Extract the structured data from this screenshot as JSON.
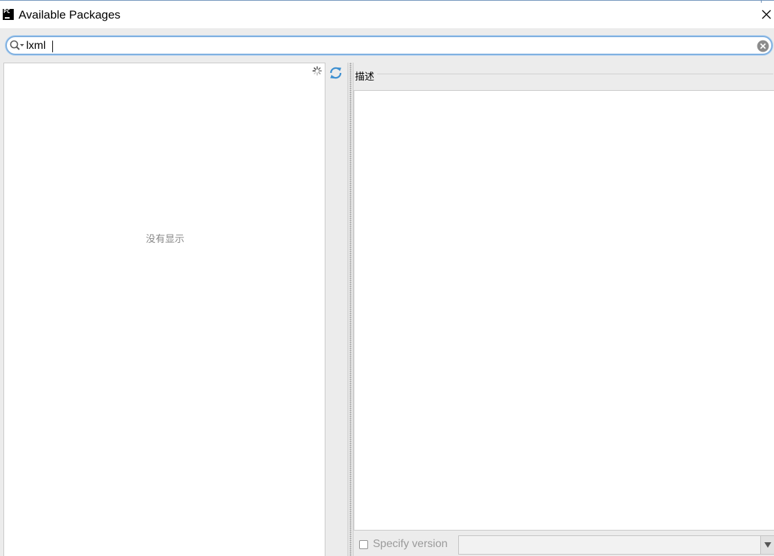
{
  "window": {
    "title": "Available Packages",
    "app_icon": "pycharm-logo",
    "app_icon_text": "PC"
  },
  "search": {
    "value": "lxml",
    "placeholder": ""
  },
  "package_list": {
    "empty_text": "没有显示"
  },
  "description": {
    "label": "描述"
  },
  "footer": {
    "specify_version_label": "Specify version",
    "specify_version_checked": false,
    "version_value": ""
  },
  "icons": [
    "pycharm-logo",
    "close-icon",
    "search-icon",
    "chevron-down-icon",
    "clear-icon",
    "spinner-icon",
    "refresh-icon",
    "dropdown-arrow-icon"
  ],
  "colors": {
    "focus_ring": "#7fb0e0",
    "refresh_accent": "#3d8fd1",
    "disabled_text": "#9a9a9a"
  }
}
